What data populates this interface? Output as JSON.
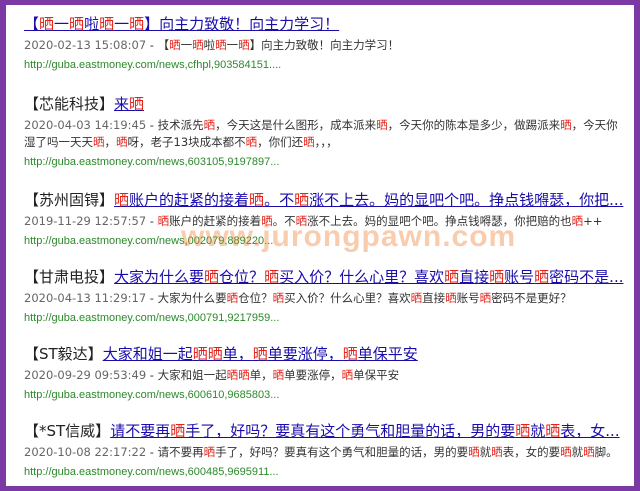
{
  "results": [
    {
      "tag": "",
      "title": [
        [
          "【",
          0
        ],
        [
          "晒",
          1
        ],
        [
          "一",
          0
        ],
        [
          "晒",
          1
        ],
        [
          "啦",
          0
        ],
        [
          "晒",
          1
        ],
        [
          "一",
          0
        ],
        [
          "晒",
          1
        ],
        [
          "】向主力致敬！向主力学习！",
          0
        ]
      ],
      "date": "2020-02-13 15:08:07",
      "snippet": [
        [
          " - 【",
          0
        ],
        [
          "晒",
          1
        ],
        [
          "一",
          0
        ],
        [
          "晒",
          1
        ],
        [
          "啦",
          0
        ],
        [
          "晒",
          1
        ],
        [
          "一",
          0
        ],
        [
          "晒",
          1
        ],
        [
          "】向主力致敬！向主力学习！",
          0
        ]
      ],
      "url": "http://guba.eastmoney.com/news,cfhpl,903584151...."
    },
    {
      "tag": "【芯能科技】",
      "title": [
        [
          "来",
          0
        ],
        [
          "晒",
          1
        ]
      ],
      "date": "2020-04-03 14:19:45",
      "snippet": [
        [
          " - 技术派先",
          0
        ],
        [
          "晒",
          1
        ],
        [
          "，今天这是什么图形，成本派来",
          0
        ],
        [
          "晒",
          1
        ],
        [
          "，今天你的陈本是多少，做踢派来",
          0
        ],
        [
          "晒",
          1
        ],
        [
          "，今天你湿了吗一天天",
          0
        ],
        [
          "晒",
          1
        ],
        [
          "，",
          0
        ],
        [
          "晒",
          1
        ],
        [
          "呀，老子13块成本都不",
          0
        ],
        [
          "晒",
          1
        ],
        [
          "，你们还",
          0
        ],
        [
          "晒",
          1
        ],
        [
          "，，，",
          0
        ]
      ],
      "url": "http://guba.eastmoney.com/news,603105,9197897..."
    },
    {
      "tag": "【苏州固锝】",
      "title": [
        [
          "晒",
          1
        ],
        [
          "账户的赶紧的接着",
          0
        ],
        [
          "晒",
          1
        ],
        [
          "。不",
          0
        ],
        [
          "晒",
          1
        ],
        [
          "涨不上去。妈的显吧个吧。挣点钱嘚瑟，你把...",
          0
        ]
      ],
      "date": "2019-11-29 12:57:57",
      "snippet": [
        [
          " - ",
          0
        ],
        [
          "晒",
          1
        ],
        [
          "账户的赶紧的接着",
          0
        ],
        [
          "晒",
          1
        ],
        [
          "。不",
          0
        ],
        [
          "晒",
          1
        ],
        [
          "涨不上去。妈的显吧个吧。挣点钱嘚瑟，你把赔的也",
          0
        ],
        [
          "晒",
          1
        ],
        [
          "++",
          0
        ]
      ],
      "url": "http://guba.eastmoney.com/news,002079,889220..."
    },
    {
      "tag": "【甘肃电投】",
      "title": [
        [
          "大家为什么要",
          0
        ],
        [
          "晒",
          1
        ],
        [
          "仓位？",
          0
        ],
        [
          "晒",
          1
        ],
        [
          "买入价？什么心里？喜欢",
          0
        ],
        [
          "晒",
          1
        ],
        [
          "直接",
          0
        ],
        [
          "晒",
          1
        ],
        [
          "账号",
          0
        ],
        [
          "晒",
          1
        ],
        [
          "密码不是...",
          0
        ]
      ],
      "date": "2020-04-13 11:29:17",
      "snippet": [
        [
          " - 大家为什么要",
          0
        ],
        [
          "晒",
          1
        ],
        [
          "仓位？",
          0
        ],
        [
          "晒",
          1
        ],
        [
          "买入价？什么心里？喜欢",
          0
        ],
        [
          "晒",
          1
        ],
        [
          "直接",
          0
        ],
        [
          "晒",
          1
        ],
        [
          "账号",
          0
        ],
        [
          "晒",
          1
        ],
        [
          "密码不是更好？",
          0
        ]
      ],
      "url": "http://guba.eastmoney.com/news,000791,9217959..."
    },
    {
      "tag": "【ST毅达】",
      "title": [
        [
          "大家和姐一起",
          0
        ],
        [
          "晒晒",
          1
        ],
        [
          "单，",
          0
        ],
        [
          "晒",
          1
        ],
        [
          "单要涨停，",
          0
        ],
        [
          "晒",
          1
        ],
        [
          "单保平安",
          0
        ]
      ],
      "date": "2020-09-29 09:53:49",
      "snippet": [
        [
          " - 大家和姐一起",
          0
        ],
        [
          "晒晒",
          1
        ],
        [
          "单，",
          0
        ],
        [
          "晒",
          1
        ],
        [
          "单要涨停，",
          0
        ],
        [
          "晒",
          1
        ],
        [
          "单保平安",
          0
        ]
      ],
      "url": "http://guba.eastmoney.com/news,600610,9685803..."
    },
    {
      "tag": "【*ST信威】",
      "title": [
        [
          "请不要再",
          0
        ],
        [
          "晒",
          1
        ],
        [
          "手了，好吗？要真有这个勇气和胆量的话，男的要",
          0
        ],
        [
          "晒",
          1
        ],
        [
          "就",
          0
        ],
        [
          "晒",
          1
        ],
        [
          "表，女...",
          0
        ]
      ],
      "date": "2020-10-08 22:17:22",
      "snippet": [
        [
          " - 请不要再",
          0
        ],
        [
          "晒",
          1
        ],
        [
          "手了，好吗？要真有这个勇气和胆量的话，男的要",
          0
        ],
        [
          "晒",
          1
        ],
        [
          "就",
          0
        ],
        [
          "晒",
          1
        ],
        [
          "表，女的要",
          0
        ],
        [
          "晒",
          1
        ],
        [
          "就",
          0
        ],
        [
          "晒",
          1
        ],
        [
          "脚。",
          0
        ]
      ],
      "url": "http://guba.eastmoney.com/news,600485,9695911..."
    }
  ],
  "watermark": "www.jurongpawn.com"
}
